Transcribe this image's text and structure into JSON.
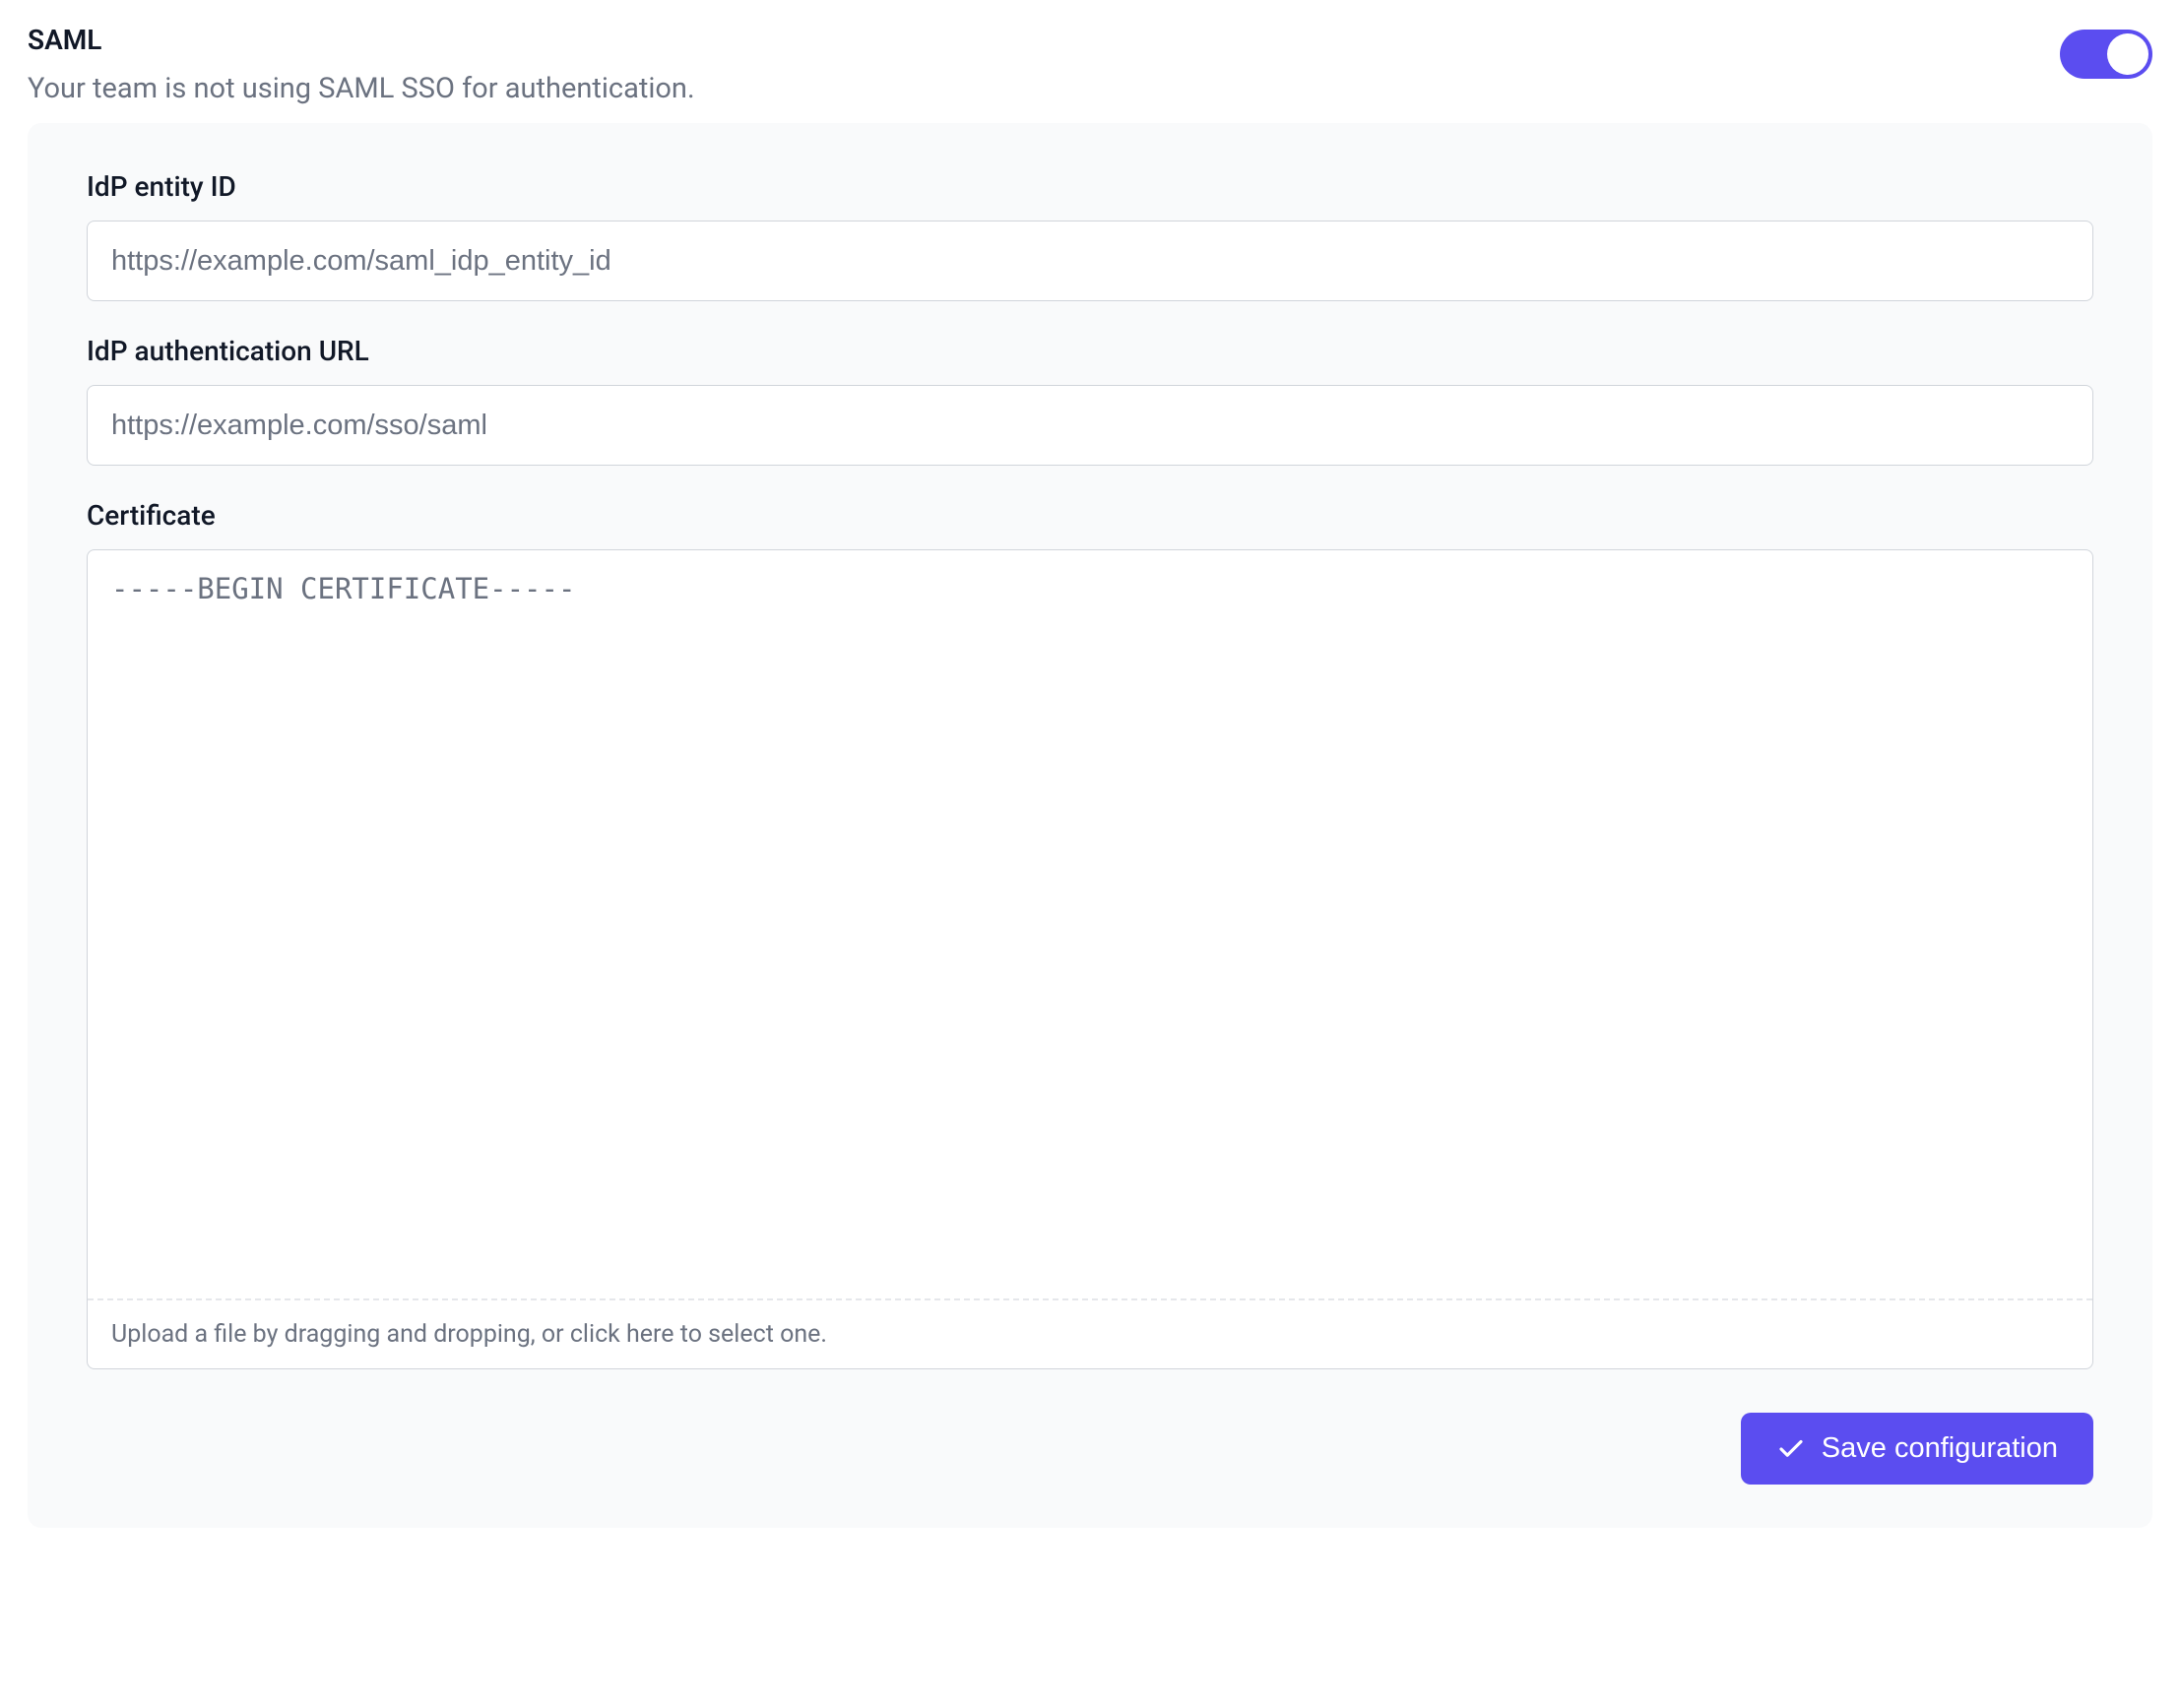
{
  "header": {
    "title": "SAML",
    "subtitle": "Your team is not using SAML SSO for authentication.",
    "toggle_on": true
  },
  "form": {
    "idp_entity": {
      "label": "IdP entity ID",
      "placeholder": "https://example.com/saml_idp_entity_id",
      "value": ""
    },
    "idp_auth_url": {
      "label": "IdP authentication URL",
      "placeholder": "https://example.com/sso/saml",
      "value": ""
    },
    "certificate": {
      "label": "Certificate",
      "placeholder": "-----BEGIN CERTIFICATE-----",
      "value": "",
      "upload_hint": "Upload a file by dragging and dropping, or click here to select one."
    },
    "save_label": "Save configuration"
  }
}
